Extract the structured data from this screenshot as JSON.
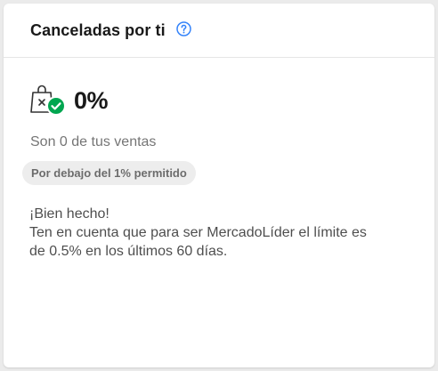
{
  "card": {
    "title": "Canceladas por ti",
    "help_icon": "question-circle-icon",
    "metric_icon": "shopping-bag-cancel-check-icon",
    "metric_value": "0%",
    "subtext": "Son 0 de tus ventas",
    "badge": "Por debajo del 1% permitido",
    "message_lines": [
      "¡Bien hecho!",
      "Ten en cuenta que para ser MercadoLíder el límite es",
      "de 0.5% en los últimos 60 días."
    ]
  },
  "colors": {
    "accent_blue": "#3483fa",
    "success_green": "#00a650",
    "background": "#ebebeb"
  }
}
